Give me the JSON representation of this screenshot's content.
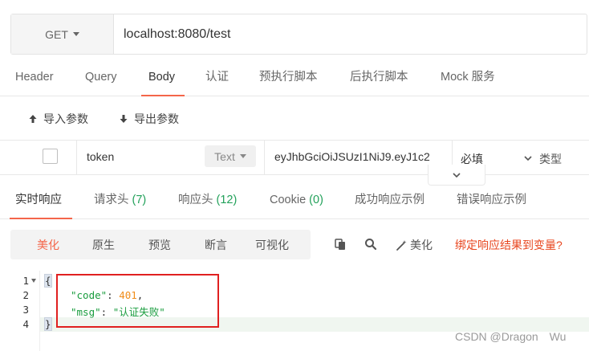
{
  "request": {
    "method": "GET",
    "url": "localhost:8080/test"
  },
  "request_tabs": [
    {
      "label": "Header"
    },
    {
      "label": "Query"
    },
    {
      "label": "Body"
    },
    {
      "label": "认证"
    },
    {
      "label": "预执行脚本"
    },
    {
      "label": "后执行脚本"
    },
    {
      "label": "Mock 服务"
    }
  ],
  "active_request_tab": "Body",
  "tools": {
    "import_label": "导入参数",
    "export_label": "导出参数"
  },
  "params": [
    {
      "name": "token",
      "type": "Text",
      "value": "eyJhbGciOiJSUzI1NiJ9.eyJ1c2",
      "required": "必填",
      "type_label": "类型"
    }
  ],
  "response_tabs": [
    {
      "label": "实时响应",
      "count": ""
    },
    {
      "label": "请求头",
      "count": "(7)"
    },
    {
      "label": "响应头",
      "count": "(12)"
    },
    {
      "label": "Cookie",
      "count": "(0)"
    },
    {
      "label": "成功响应示例",
      "count": ""
    },
    {
      "label": "错误响应示例",
      "count": ""
    }
  ],
  "active_response_tab": "实时响应",
  "view_modes": [
    {
      "label": "美化"
    },
    {
      "label": "原生"
    },
    {
      "label": "预览"
    },
    {
      "label": "断言"
    },
    {
      "label": "可视化"
    }
  ],
  "active_view_mode": "美化",
  "toolbar": {
    "beautify_label": "美化",
    "bind_label": "绑定响应结果到变量?"
  },
  "response_body": {
    "line_numbers": [
      "1",
      "2",
      "3",
      "4"
    ],
    "open_brace": "{",
    "close_brace": "}",
    "code_key": "\"code\"",
    "code_value": "401",
    "msg_key": "\"msg\"",
    "msg_value": "\"认证失败\""
  },
  "watermark": "CSDN @Dragon　Wu",
  "colors": {
    "accent": "#f4664a",
    "count_green": "#22a15a",
    "json_key": "#1a9d3f",
    "json_number": "#f08d1a",
    "annotation_red": "#e02020"
  },
  "icons": {
    "import": "arrow-up-icon",
    "export": "arrow-down-icon",
    "copy": "copy-icon",
    "search": "search-icon",
    "beautify": "magic-wand-icon"
  }
}
